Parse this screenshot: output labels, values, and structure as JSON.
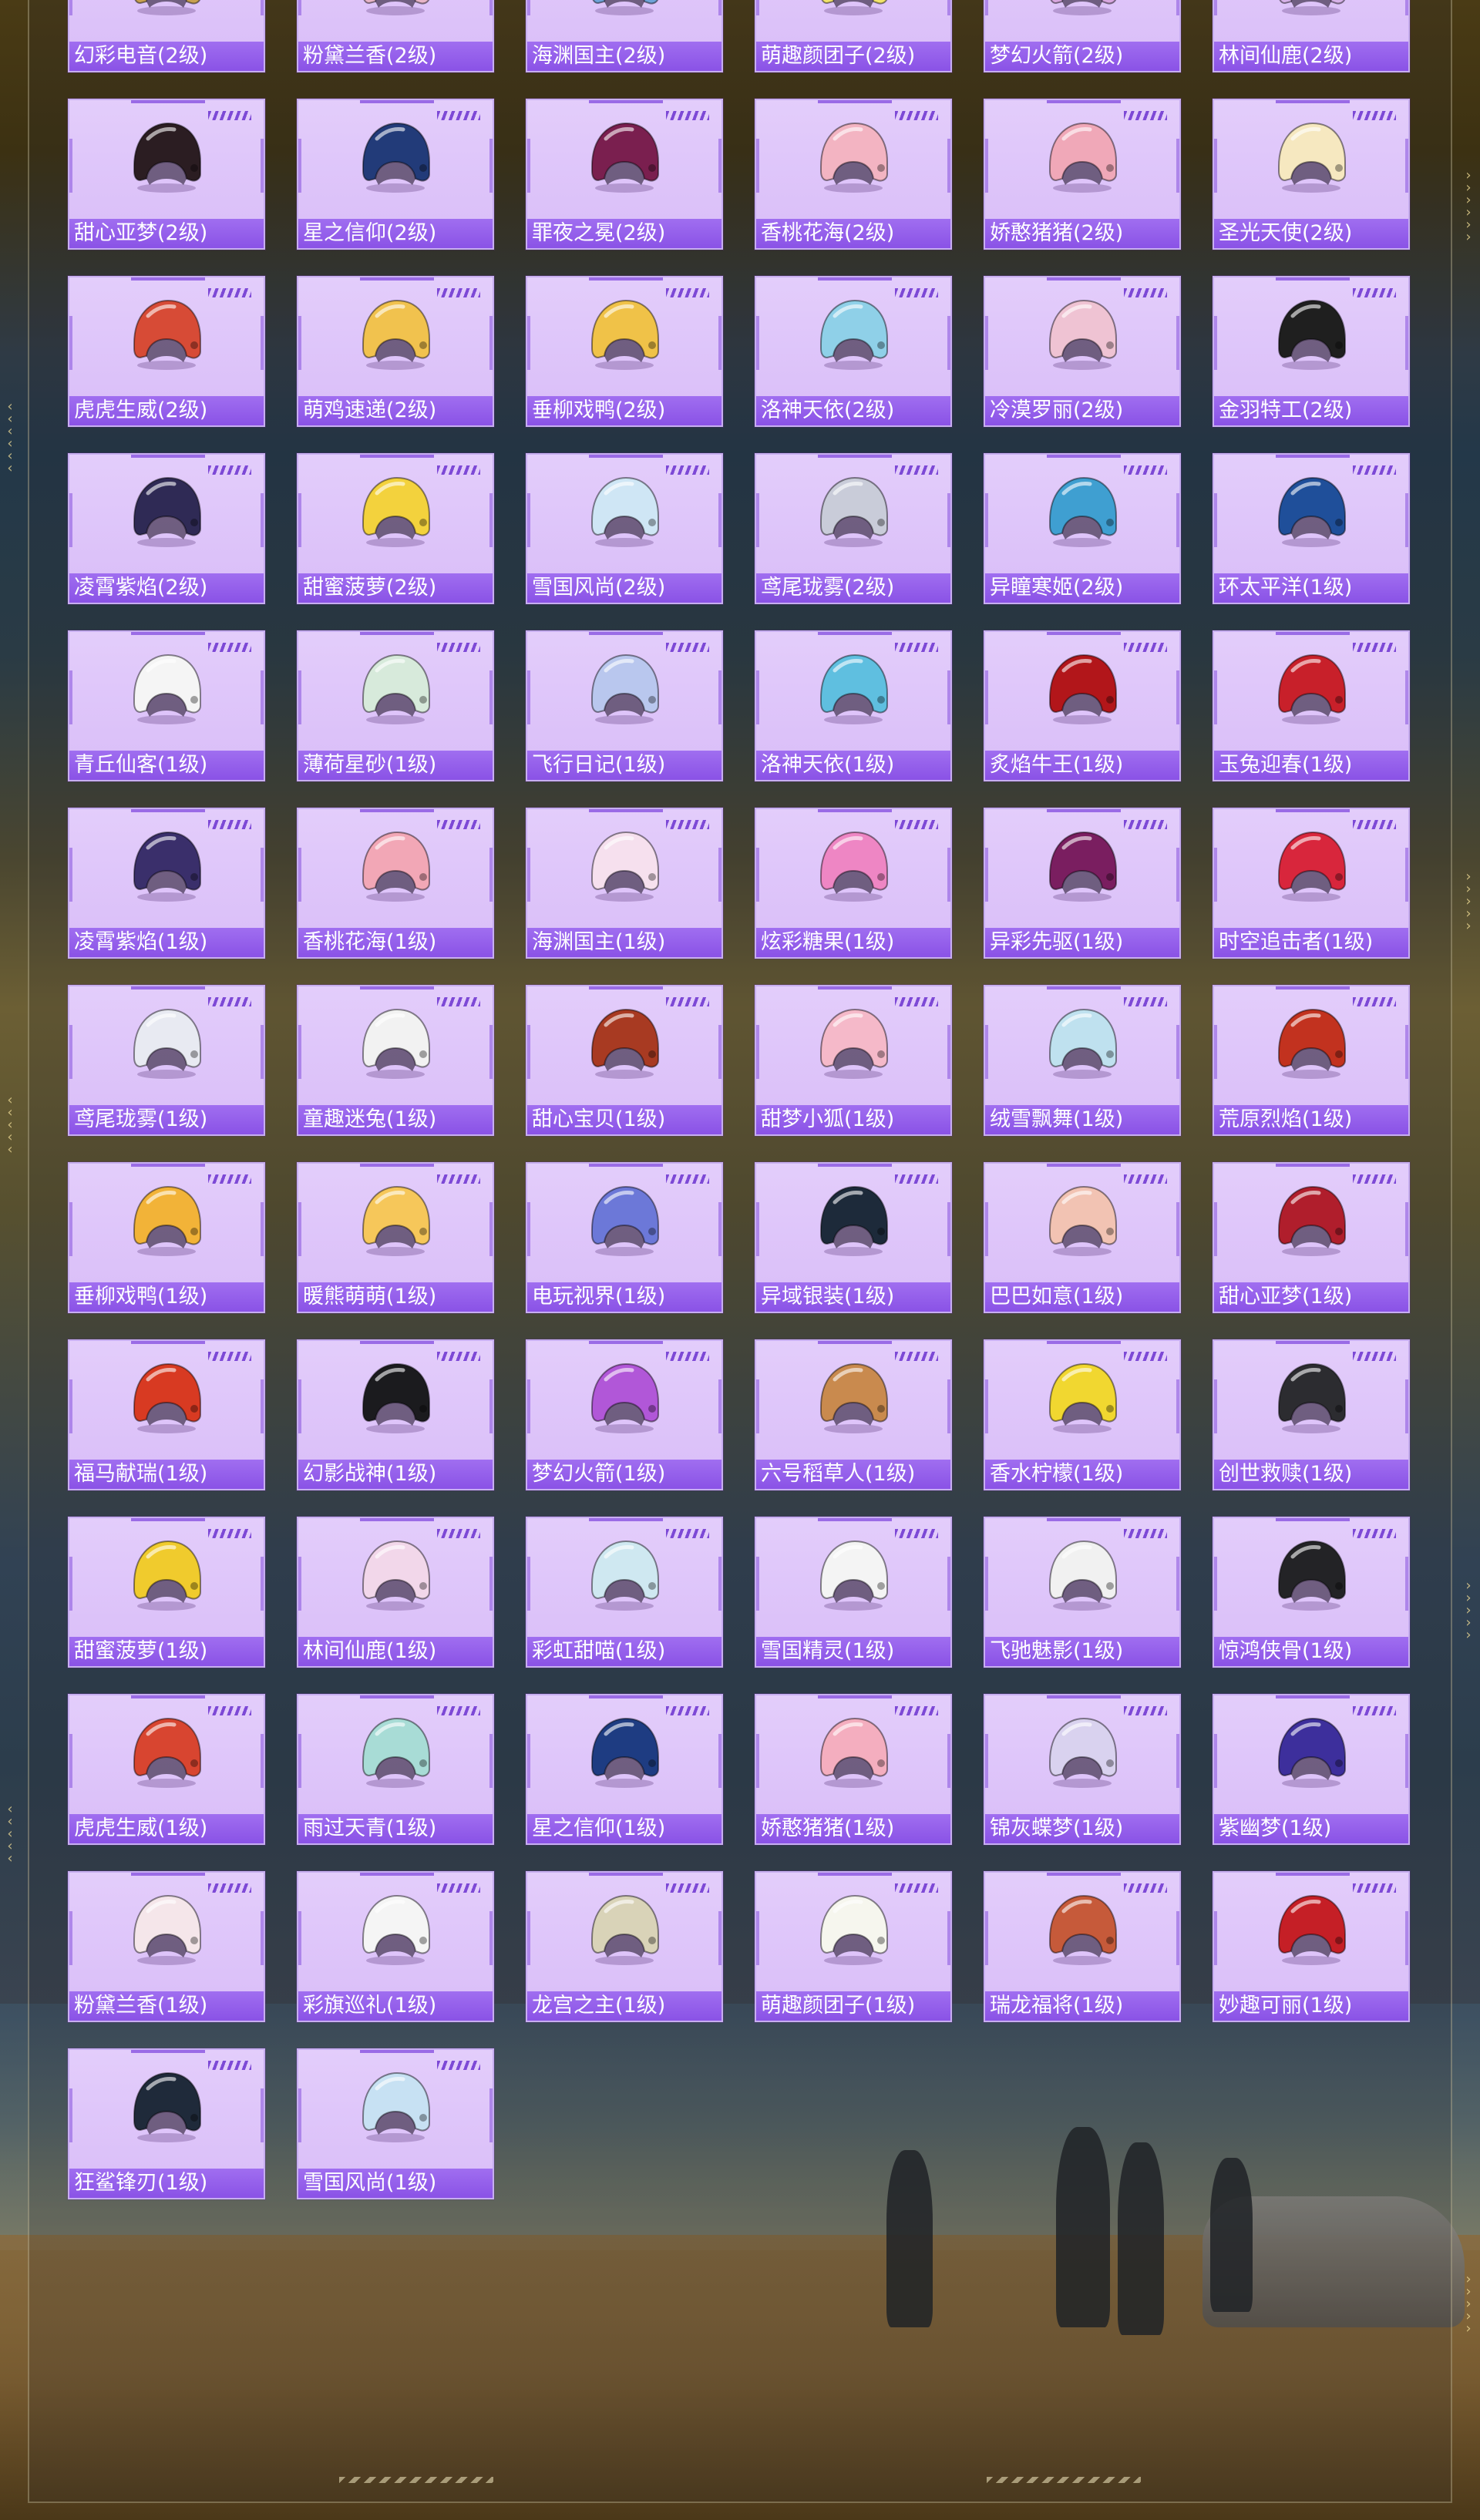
{
  "colors": {
    "card_bg": "#dcc2f9",
    "label_bar": "#9460ea",
    "label_text": "#ffffff"
  },
  "items": [
    {
      "name": "幻彩电音(2级)",
      "icon": "helmet-icon",
      "color": "#c8a050"
    },
    {
      "name": "粉黛兰香(2级)",
      "icon": "helmet-icon",
      "color": "#e7b5c8"
    },
    {
      "name": "海渊国主(2级)",
      "icon": "helmet-icon",
      "color": "#6fa3d8"
    },
    {
      "name": "萌趣颜团子(2级)",
      "icon": "helmet-icon",
      "color": "#f2e36a"
    },
    {
      "name": "梦幻火箭(2级)",
      "icon": "helmet-icon",
      "color": "#d8a7e0"
    },
    {
      "name": "林间仙鹿(2级)",
      "icon": "helmet-icon",
      "color": "#d7b3e9"
    },
    {
      "name": "甜心亚梦(2级)",
      "icon": "helmet-icon",
      "color": "#2b1d22"
    },
    {
      "name": "星之信仰(2级)",
      "icon": "helmet-icon",
      "color": "#223b79"
    },
    {
      "name": "罪夜之冕(2级)",
      "icon": "helmet-icon",
      "color": "#7a1f4f"
    },
    {
      "name": "香桃花海(2级)",
      "icon": "helmet-icon",
      "color": "#f3b4c2"
    },
    {
      "name": "娇憨猪猪(2级)",
      "icon": "helmet-icon",
      "color": "#f0a8b8"
    },
    {
      "name": "圣光天使(2级)",
      "icon": "helmet-icon",
      "color": "#f6e8c0"
    },
    {
      "name": "虎虎生威(2级)",
      "icon": "helmet-icon",
      "color": "#d74b36"
    },
    {
      "name": "萌鸡速递(2级)",
      "icon": "helmet-icon",
      "color": "#f1c24e"
    },
    {
      "name": "垂柳戏鸭(2级)",
      "icon": "helmet-icon",
      "color": "#f0c248"
    },
    {
      "name": "洛神天依(2级)",
      "icon": "helmet-icon",
      "color": "#8fd0e8"
    },
    {
      "name": "冷漠罗丽(2级)",
      "icon": "helmet-icon",
      "color": "#efc3d3"
    },
    {
      "name": "金羽特工(2级)",
      "icon": "helmet-icon",
      "color": "#1f1f1f"
    },
    {
      "name": "凌霄紫焰(2级)",
      "icon": "helmet-icon",
      "color": "#2f2a55"
    },
    {
      "name": "甜蜜菠萝(2级)",
      "icon": "helmet-icon",
      "color": "#f3d23d"
    },
    {
      "name": "雪国风尚(2级)",
      "icon": "helmet-icon",
      "color": "#cfe6f5"
    },
    {
      "name": "鸢尾珑雾(2级)",
      "icon": "helmet-icon",
      "color": "#c9ccd9"
    },
    {
      "name": "异瞳寒姬(2级)",
      "icon": "helmet-icon",
      "color": "#3f9fd1"
    },
    {
      "name": "环太平洋(1级)",
      "icon": "helmet-icon",
      "color": "#1f4f9a"
    },
    {
      "name": "青丘仙客(1级)",
      "icon": "helmet-icon",
      "color": "#f5f5f5"
    },
    {
      "name": "薄荷星砂(1级)",
      "icon": "helmet-icon",
      "color": "#d7eadb"
    },
    {
      "name": "飞行日记(1级)",
      "icon": "helmet-icon",
      "color": "#b9c7ee"
    },
    {
      "name": "洛神天依(1级)",
      "icon": "helmet-icon",
      "color": "#5fbfe0"
    },
    {
      "name": "炙焰牛王(1级)",
      "icon": "helmet-icon",
      "color": "#b2161a"
    },
    {
      "name": "玉兔迎春(1级)",
      "icon": "helmet-icon",
      "color": "#c8202a"
    },
    {
      "name": "凌霄紫焰(1级)",
      "icon": "helmet-icon",
      "color": "#3a2f6b"
    },
    {
      "name": "香桃花海(1级)",
      "icon": "helmet-icon",
      "color": "#f2a7b6"
    },
    {
      "name": "海渊国主(1级)",
      "icon": "helmet-icon",
      "color": "#f6e0ee"
    },
    {
      "name": "炫彩糖果(1级)",
      "icon": "helmet-icon",
      "color": "#ee86c4"
    },
    {
      "name": "异彩先驱(1级)",
      "icon": "helmet-icon",
      "color": "#7a1e60"
    },
    {
      "name": "时空追击者(1级)",
      "icon": "helmet-icon",
      "color": "#d8263c"
    },
    {
      "name": "鸢尾珑雾(1级)",
      "icon": "helmet-icon",
      "color": "#e8eaf2"
    },
    {
      "name": "童趣迷兔(1级)",
      "icon": "helmet-icon",
      "color": "#f2f2f2"
    },
    {
      "name": "甜心宝贝(1级)",
      "icon": "helmet-icon",
      "color": "#a83a22"
    },
    {
      "name": "甜梦小狐(1级)",
      "icon": "helmet-icon",
      "color": "#f5b9c9"
    },
    {
      "name": "绒雪飘舞(1级)",
      "icon": "helmet-icon",
      "color": "#bfe1ef"
    },
    {
      "name": "荒原烈焰(1级)",
      "icon": "helmet-icon",
      "color": "#c2321f"
    },
    {
      "name": "垂柳戏鸭(1级)",
      "icon": "helmet-icon",
      "color": "#f2b338"
    },
    {
      "name": "暖熊萌萌(1级)",
      "icon": "helmet-icon",
      "color": "#f6c75a"
    },
    {
      "name": "电玩视界(1级)",
      "icon": "helmet-icon",
      "color": "#6c78d8"
    },
    {
      "name": "异域银装(1级)",
      "icon": "helmet-icon",
      "color": "#1d2a3a"
    },
    {
      "name": "巴巴如意(1级)",
      "icon": "helmet-icon",
      "color": "#f2c3b3"
    },
    {
      "name": "甜心亚梦(1级)",
      "icon": "helmet-icon",
      "color": "#b01e2c"
    },
    {
      "name": "福马献瑞(1级)",
      "icon": "helmet-icon",
      "color": "#d83a22"
    },
    {
      "name": "幻影战神(1级)",
      "icon": "helmet-icon",
      "color": "#1b1b1e"
    },
    {
      "name": "梦幻火箭(1级)",
      "icon": "helmet-icon",
      "color": "#b157d8"
    },
    {
      "name": "六号稻草人(1级)",
      "icon": "helmet-icon",
      "color": "#c98a4e"
    },
    {
      "name": "香水柠檬(1级)",
      "icon": "helmet-icon",
      "color": "#f1d730"
    },
    {
      "name": "创世救赎(1级)",
      "icon": "helmet-icon",
      "color": "#2c2c30"
    },
    {
      "name": "甜蜜菠萝(1级)",
      "icon": "helmet-icon",
      "color": "#f0cb2d"
    },
    {
      "name": "林间仙鹿(1级)",
      "icon": "helmet-icon",
      "color": "#f2d7ea"
    },
    {
      "name": "彩虹甜喵(1级)",
      "icon": "helmet-icon",
      "color": "#cfe8f1"
    },
    {
      "name": "雪国精灵(1级)",
      "icon": "helmet-icon",
      "color": "#f4f4f4"
    },
    {
      "name": "飞驰魅影(1级)",
      "icon": "helmet-icon",
      "color": "#f1f1f1"
    },
    {
      "name": "惊鸿侠骨(1级)",
      "icon": "helmet-icon",
      "color": "#232326"
    },
    {
      "name": "虎虎生威(1级)",
      "icon": "helmet-icon",
      "color": "#d84530"
    },
    {
      "name": "雨过天青(1级)",
      "icon": "helmet-icon",
      "color": "#a8dcd6"
    },
    {
      "name": "星之信仰(1级)",
      "icon": "helmet-icon",
      "color": "#1e3c82"
    },
    {
      "name": "娇憨猪猪(1级)",
      "icon": "helmet-icon",
      "color": "#f4aebf"
    },
    {
      "name": "锦灰蝶梦(1级)",
      "icon": "helmet-icon",
      "color": "#d9d2ef"
    },
    {
      "name": "紫幽梦(1级)",
      "icon": "helmet-icon",
      "color": "#3d2f9c"
    },
    {
      "name": "粉黛兰香(1级)",
      "icon": "helmet-icon",
      "color": "#f5e6ea"
    },
    {
      "name": "彩旗巡礼(1级)",
      "icon": "helmet-icon",
      "color": "#f5f5f5"
    },
    {
      "name": "龙宫之主(1级)",
      "icon": "helmet-icon",
      "color": "#d9d3b8"
    },
    {
      "name": "萌趣颜团子(1级)",
      "icon": "helmet-icon",
      "color": "#f6f6ee"
    },
    {
      "name": "瑞龙福将(1级)",
      "icon": "helmet-icon",
      "color": "#c65a3a"
    },
    {
      "name": "妙趣可丽(1级)",
      "icon": "helmet-icon",
      "color": "#c51f26"
    },
    {
      "name": "狂鲨锋刃(1级)",
      "icon": "helmet-icon",
      "color": "#1f2a3a"
    },
    {
      "name": "雪国风尚(1级)",
      "icon": "helmet-icon",
      "color": "#c7e1f3"
    }
  ]
}
